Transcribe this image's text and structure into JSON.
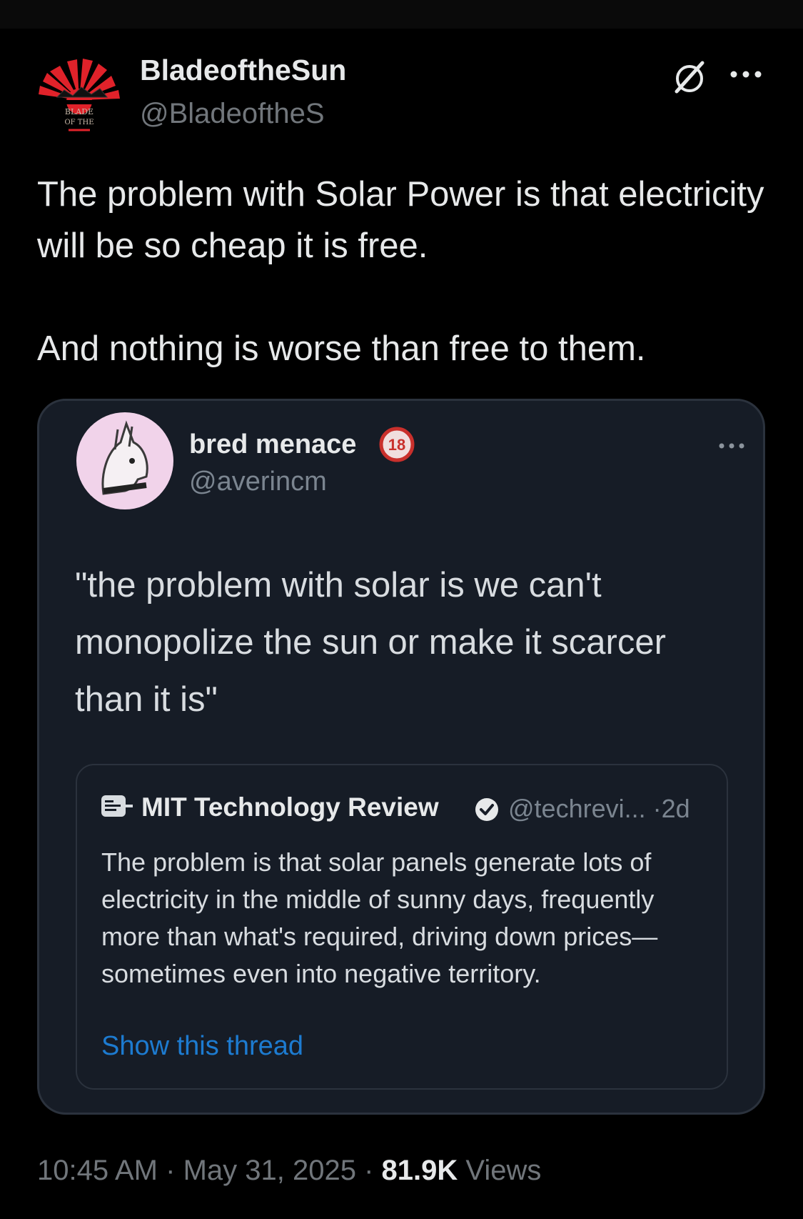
{
  "author": {
    "display_name": "BladeoftheSun",
    "handle": "@BladeoftheS",
    "avatar_text": [
      "BLADE",
      "OF THE"
    ]
  },
  "tweet": {
    "text": "The problem with Solar Power is that electricity will be so cheap it is free.\n\nAnd nothing is worse than free to them."
  },
  "quoted": {
    "display_name": "bred menace",
    "badge": "18",
    "handle": "@averincm",
    "text": "\"the problem with solar is we can't monopolize the sun or make it scarcer than it is\"",
    "inner": {
      "name": "MIT Technology Review",
      "handle": "@techrevi...",
      "separator": "·",
      "age": "2d",
      "text": "The problem is that solar panels generate lots of electricity in the middle of sunny days, frequently more than what's required, driving down prices—sometimes even into negative territory.",
      "show_thread": "Show this thread"
    }
  },
  "meta": {
    "time": "10:45 AM",
    "sep1": " · ",
    "date": "May 31, 2025",
    "sep2": " · ",
    "views_count": "81.9K",
    "views_label": "Views"
  },
  "icons": {
    "grok": "grok-icon",
    "more": "more-icon",
    "verified": "verified-icon",
    "age_badge": "age-18-icon"
  },
  "colors": {
    "background": "#000000",
    "text_primary": "#e7e9ea",
    "text_secondary": "#71767b",
    "link": "#1d7bd0",
    "card_bg": "#161c26",
    "sun_red": "#e0222a"
  }
}
